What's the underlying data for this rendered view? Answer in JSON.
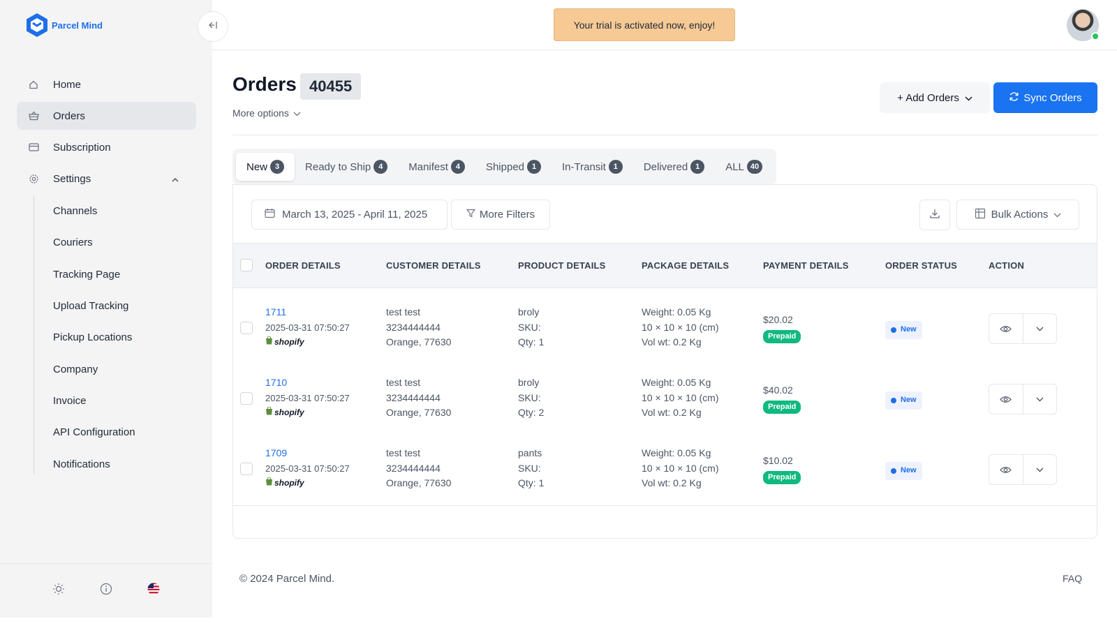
{
  "brand": {
    "name": "Parcel Mind"
  },
  "topbar": {
    "trial_message": "Your trial is activated now, enjoy!"
  },
  "sidebar": {
    "items": [
      {
        "label": "Home",
        "icon": "home-icon"
      },
      {
        "label": "Orders",
        "icon": "basket-icon"
      },
      {
        "label": "Subscription",
        "icon": "card-icon"
      },
      {
        "label": "Settings",
        "icon": "gear-icon"
      }
    ],
    "settings_items": [
      "Channels",
      "Couriers",
      "Tracking Page",
      "Upload Tracking",
      "Pickup Locations",
      "Company",
      "Invoice",
      "API Configuration",
      "Notifications"
    ]
  },
  "header": {
    "title": "Orders",
    "count": "40455",
    "more_options": "More options",
    "add_orders": "+ Add Orders",
    "sync_orders": "Sync Orders"
  },
  "tabs": [
    {
      "label": "New",
      "count": "3"
    },
    {
      "label": "Ready to Ship",
      "count": "4"
    },
    {
      "label": "Manifest",
      "count": "4"
    },
    {
      "label": "Shipped",
      "count": "1"
    },
    {
      "label": "In-Transit",
      "count": "1"
    },
    {
      "label": "Delivered",
      "count": "1"
    },
    {
      "label": "ALL",
      "count": "40"
    }
  ],
  "toolbar": {
    "date_range": "March 13, 2025 - April 11, 2025",
    "more_filters": "More Filters",
    "bulk_actions": "Bulk Actions"
  },
  "table": {
    "columns": [
      "ORDER DETAILS",
      "CUSTOMER DETAILS",
      "PRODUCT DETAILS",
      "PACKAGE DETAILS",
      "PAYMENT DETAILS",
      "ORDER STATUS",
      "ACTION"
    ],
    "rows": [
      {
        "order_id": "1711",
        "timestamp": "2025-03-31 07:50:27",
        "channel": "shopify",
        "customer_name": "test test",
        "customer_phone": "3234444444",
        "customer_location": "Orange, 77630",
        "product": "broly",
        "sku": "SKU:",
        "qty": "Qty: 1",
        "weight": "Weight: 0.05 Kg",
        "dims": "10 × 10 × 10 (cm)",
        "volwt": "Vol wt: 0.2 Kg",
        "amount": "$20.02",
        "payment": "Prepaid",
        "status": "New"
      },
      {
        "order_id": "1710",
        "timestamp": "2025-03-31 07:50:27",
        "channel": "shopify",
        "customer_name": "test test",
        "customer_phone": "3234444444",
        "customer_location": "Orange, 77630",
        "product": "broly",
        "sku": "SKU:",
        "qty": "Qty: 2",
        "weight": "Weight: 0.05 Kg",
        "dims": "10 × 10 × 10 (cm)",
        "volwt": "Vol wt: 0.2 Kg",
        "amount": "$40.02",
        "payment": "Prepaid",
        "status": "New"
      },
      {
        "order_id": "1709",
        "timestamp": "2025-03-31 07:50:27",
        "channel": "shopify",
        "customer_name": "test test",
        "customer_phone": "3234444444",
        "customer_location": "Orange, 77630",
        "product": "pants",
        "sku": "SKU:",
        "qty": "Qty: 1",
        "weight": "Weight: 0.05 Kg",
        "dims": "10 × 10 × 10 (cm)",
        "volwt": "Vol wt: 0.2 Kg",
        "amount": "$10.02",
        "payment": "Prepaid",
        "status": "New"
      }
    ]
  },
  "footer": {
    "copyright": "© 2024 Parcel Mind.",
    "faq": "FAQ"
  },
  "colors": {
    "accent": "#1a73f0",
    "prepaid": "#10b981",
    "trial_banner": "#f6c995"
  }
}
